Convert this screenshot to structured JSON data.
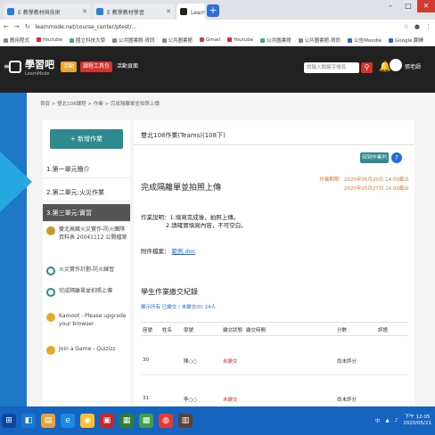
{
  "browser": {
    "tabs": [
      {
        "title": "E 教學教材與技術",
        "color": "#2d7fd6"
      },
      {
        "title": "E 教學教材學習",
        "color": "#2d7fd6"
      },
      {
        "title": "LearnMode學習吧",
        "color": "#222222"
      }
    ],
    "new_tab": "+",
    "url": "learnmode.net/course_center/ptest/..."
  },
  "bookmarks": [
    "應用程式",
    "Youtube",
    "國立科技大學",
    "公共圖書館-資訊",
    "公共圖書館",
    "Gmail",
    "Youtube",
    "公共圖書館",
    "公共圖書館-資訊",
    "公告Moodle",
    "Google 翻譯"
  ],
  "header": {
    "brand": "學習吧",
    "brand_sub": "LearnMode",
    "badges": [
      "活動",
      "課程工具包",
      "活動頁面"
    ],
    "search_placeholder": "請輸入關鍵字搜尋",
    "user_name": "張老師"
  },
  "breadcrumb": "首頁 > 雙北108課程 > 作業 > 完成隔離單並拍照上傳",
  "sidebar": {
    "add_button": "+ 新增作業",
    "items": [
      "1.第一單元簡介",
      "2.第二單元:火災作業",
      "3.第三單元:實習"
    ],
    "sub_items": [
      {
        "label": "雙北高職火災實作-防火團隊資料表 20041112 公開檔案",
        "color": "#c79a2a"
      },
      {
        "label": "火災實作計劃-防火練習",
        "color": "#2d8a8e"
      },
      {
        "label": "完成隔離單並拍照上傳",
        "color": "#2d8a8e"
      },
      {
        "label": "Kamoot - Please upgrade your browser",
        "color": "#e8a62a"
      },
      {
        "label": "Join a Game - Quizizz",
        "color": "#e8a62a"
      }
    ]
  },
  "main": {
    "title": "雙北108作業(Teams)(108下)",
    "homework_button": "回到作業列表",
    "help": "?",
    "due_dates": [
      "作業期限：2020年05月20日 14:00截止",
      "2020年05月27日 14:00截止"
    ],
    "homework_title": "完成隔離單並拍照上傳",
    "description_label": "作業說明：",
    "description_lines": [
      "1.填寫完成後，拍照上傳。",
      "2.請確實填寫內容，不可空白。"
    ],
    "attachment_label": "附件檔案：",
    "attachment_link": "範例.doc",
    "record_title": "學生作業繳交紀錄",
    "record_subtitle": "顯示所有 已繳交 / 未繳交(0) 24人",
    "columns": [
      "座號",
      "姓名",
      "學號",
      "繳交狀態",
      "繳交時間",
      "分數",
      "評語"
    ],
    "rows": [
      {
        "seat": "30",
        "name": "陳○○",
        "status": "未繳交",
        "score": "尚未評分"
      },
      {
        "seat": "31",
        "name": "李○○",
        "status": "未繳交",
        "score": "尚未評分"
      }
    ]
  },
  "taskbar": {
    "lang": "中",
    "time": "下午 12:05",
    "date": "2020/05/21"
  }
}
